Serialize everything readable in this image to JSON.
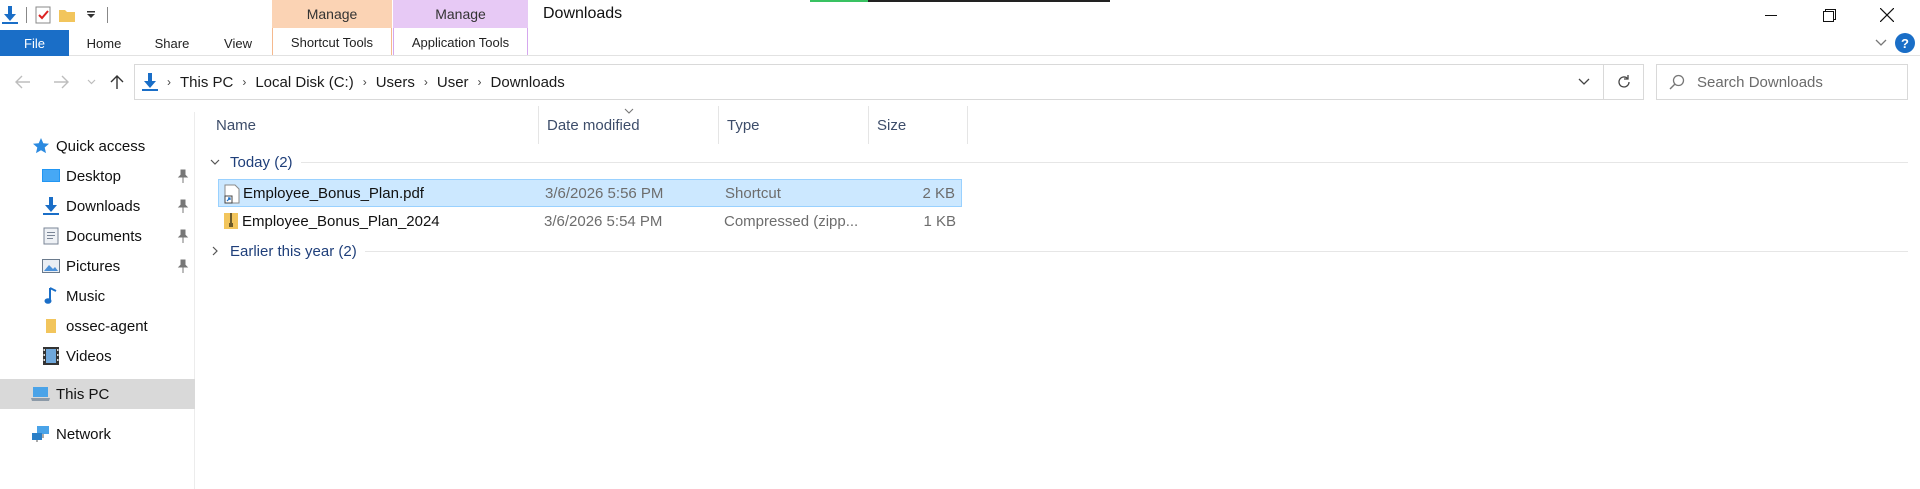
{
  "window": {
    "title": "Downloads",
    "controls": {
      "minimize": "—",
      "maximize": "❐",
      "close": "✕"
    }
  },
  "ribbon": {
    "contextual": [
      {
        "group": "Manage",
        "tab": "Shortcut Tools",
        "color": "#fbd3b4"
      },
      {
        "group": "Manage",
        "tab": "Application Tools",
        "color": "#e7c9f5"
      }
    ],
    "tabs": {
      "file": "File",
      "home": "Home",
      "share": "Share",
      "view": "View"
    },
    "accent": "#1a6ec7"
  },
  "address": {
    "crumbs": [
      "This PC",
      "Local Disk (C:)",
      "Users",
      "User",
      "Downloads"
    ]
  },
  "search": {
    "placeholder": "Search Downloads"
  },
  "sidebar": {
    "items": [
      {
        "label": "Quick access",
        "icon": "star-icon"
      },
      {
        "label": "Desktop",
        "icon": "desktop-icon",
        "pinned": true
      },
      {
        "label": "Downloads",
        "icon": "download-icon",
        "pinned": true
      },
      {
        "label": "Documents",
        "icon": "documents-icon",
        "pinned": true
      },
      {
        "label": "Pictures",
        "icon": "pictures-icon",
        "pinned": true
      },
      {
        "label": "Music",
        "icon": "music-icon"
      },
      {
        "label": "ossec-agent",
        "icon": "folder-icon"
      },
      {
        "label": "Videos",
        "icon": "videos-icon"
      },
      {
        "label": "This PC",
        "icon": "computer-icon",
        "selected": true
      },
      {
        "label": "Network",
        "icon": "network-icon"
      }
    ]
  },
  "columns": {
    "name": "Name",
    "date": "Date modified",
    "type": "Type",
    "size": "Size"
  },
  "groups": [
    {
      "label": "Today (2)",
      "expanded": true
    },
    {
      "label": "Earlier this year (2)",
      "expanded": false
    }
  ],
  "files": [
    {
      "name": "Employee_Bonus_Plan.pdf",
      "date": "3/6/2026 5:56 PM",
      "type": "Shortcut",
      "size": "2 KB",
      "selected": true,
      "icon": "shortcut-file-icon"
    },
    {
      "name": "Employee_Bonus_Plan_2024",
      "date": "3/6/2026 5:54 PM",
      "type": "Compressed (zipp...",
      "size": "1 KB",
      "selected": false,
      "icon": "zip-folder-icon"
    }
  ]
}
